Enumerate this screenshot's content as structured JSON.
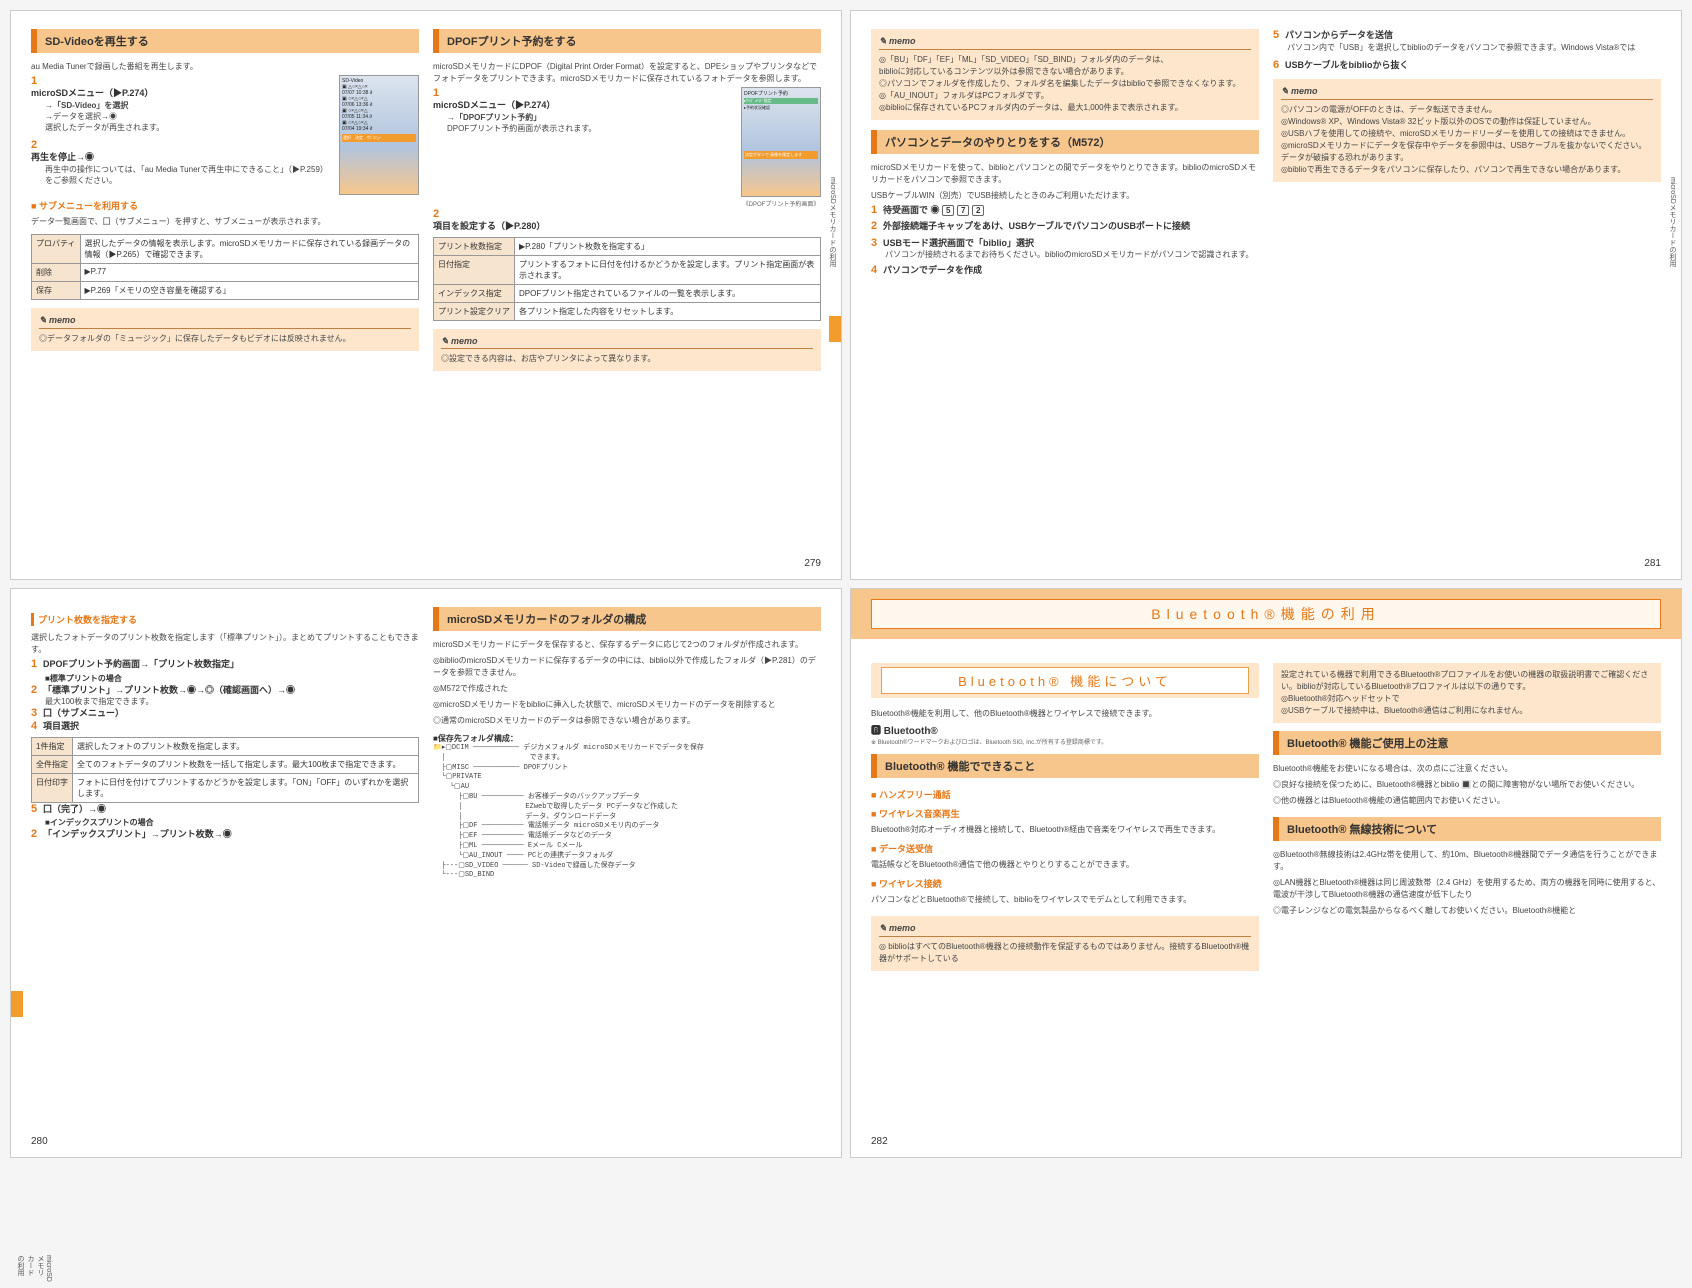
{
  "pages": {
    "p279_num": "279",
    "p280_num": "280",
    "p281_num": "281",
    "p282_num": "282",
    "side_tab": "microSDメモリカードの利用"
  },
  "p279": {
    "sd_video_header": "SD-Videoを再生する",
    "au_media": "au Media Tunerで録画した番組を再生します。",
    "step1_main": "microSDメニュー（▶P.274）",
    "step1_sub": "→「SD-Video」を選択",
    "step1_arrow": "→データを選択→◉",
    "desc1": "選択したデータが再生されます。",
    "step2": "再生を停止→◉",
    "step2_desc": "再生中の操作については、「au Media Tunerで再生中にできること」（▶P.259）をご参照ください。",
    "orange_sq1": "サブメニューを利用する",
    "sub_desc": "データ一覧画面で、囗（サブメニュー）を押すと、サブメニューが表示されます。",
    "tbl": {
      "r1a": "プロパティ",
      "r1b": "選択したデータの情報を表示します。microSDメモリカードに保存されている録画データの情報（▶P.265）で確認できます。",
      "r2a": "削除",
      "r2b": "▶P.77",
      "r3a": "保存",
      "r3b": "▶P.269「メモリの空き容量を確認する」"
    },
    "memo": "◎データフォルダの「ミュージック」に保存したデータもビデオには反映されません。"
  },
  "dpof": {
    "header": "DPOFプリント予約をする",
    "intro": "microSDメモリカードにDPOF（Digital Print Order Format）を設定すると、DPEショップやプリンタなどでフォトデータをプリントできます。microSDメモリカードに保存されているフォトデータを参照します。",
    "step1_main": "microSDメニュー（▶P.274）",
    "step1_sub": "→「DPOFプリント予約」",
    "step1_desc": "DPOFプリント予約画面が表示されます。",
    "caption": "《DPOFプリント予約画面》",
    "step2": "項目を設定する（▶P.280）",
    "tbl": {
      "r1a": "プリント枚数指定",
      "r1b": "▶P.280「プリント枚数を指定する」",
      "r2a": "日付指定",
      "r2b": "プリントするフォトに日付を付けるかどうかを設定します。プリント指定画面が表示されます。",
      "r3a": "インデックス指定",
      "r3b": "DPOFプリント指定されているファイルの一覧を表示します。",
      "r4a": "プリント設定クリア",
      "r4b": "各プリント指定した内容をリセットします。"
    },
    "memo": "◎設定できる内容は、お店やプリンタによって異なります。"
  },
  "p280": {
    "orange_bar": "プリント枚数を指定する",
    "desc1": "選択したフォトデータのプリント枚数を指定します（「標準プリント」）。まとめてプリントすることもできます。",
    "step1": "DPOFプリント予約画面→「プリント枚数指定」",
    "step1_sq": "■標準プリントの場合",
    "step2": "「標準プリント」→プリント枚数→◉→◎（確認画面へ）→◉",
    "step2_desc": "最大100枚まで指定できます。",
    "step3": "囗（サブメニュー）",
    "step4": "項目選択",
    "tbl": {
      "r1a": "1件指定",
      "r1b": "選択したフォトのプリント枚数を指定します。",
      "r2a": "全件指定",
      "r2b": "全てのフォトデータのプリント枚数を一括して指定します。最大100枚まで指定できます。",
      "r3a": "日付印字",
      "r3b": "フォトに日付を付けてプリントするかどうかを設定します。「ON」「OFF」のいずれかを選択します。"
    },
    "step5": "囗（完了）→◉",
    "step5_sq": "■インデックスプリントの場合",
    "step2b": "「インデックスプリント」→プリント枚数→◉"
  },
  "microsd_struct": {
    "header": "microSDメモリカードのフォルダの構成",
    "intro": "microSDメモリカードにデータを保存すると、保存するデータに応じて2つのフォルダが作成されます。",
    "line1": "◎biblioのmicroSDメモリカードに保存するデータの中には、biblio以外で作成したフォルダ（▶P.281）のデータを参照できません。",
    "line2": "◎M572で作成された",
    "line3": "◎microSDメモリカードをbiblioに挿入した状態で、microSDメモリカードのデータを削除すると",
    "line4": "◎通常のmicroSDメモリカードのデータは参照できない場合があります。",
    "tree_header": "■保存先フォルダ構成：",
    "tree": "📁▸▢DCIM ─────────── デジカメフォルダ microSDメモリカードでデータを保存\n  │                    できます。\n  ├▢MISC ─────────── DPOFプリント\n  └▢PRIVATE\n    └▢AU\n      ├▢BU ────────── お客様データのバックアップデータ\n      │               EZwebで取得したデータ PCデータなど作成した\n      │               データ、ダウンロードデータ\n      ├▢DF ────────── 電話帳データ microSDメモリ内のデータ\n      ├▢EF ────────── 電話帳データなどのデータ\n      ├▢ML ────────── Eメール Cメール\n      └▢AU_INOUT ──── PCとの連携データフォルダ\n  ├---▢SD_VIDEO ────── SD-Videoで録画した保存データ\n  └---▢SD_BIND"
  },
  "p281": {
    "memo1": {
      "l1": "◎「BU」「DF」「EF」「ML」「SD_VIDEO」「SD_BIND」フォルダ内のデータは、",
      "l2": "biblioに対応しているコンテンツ以外は参照できない場合があります。",
      "l3": "◎パソコンでフォルダを作成したり、フォルダ名を編集したデータはbiblioで参照できなくなります。",
      "l4": "◎「AU_INOUT」フォルダはPCフォルダです。",
      "l5": "◎biblioに保存されているPCフォルダ内のデータは、最大1,000件まで表示されます。"
    },
    "orange_header": "パソコンとデータのやりとりをする（M572）",
    "desc1": "microSDメモリカードを使って、biblioとパソコンとの間でデータをやりとりできます。biblioのmicroSDメモリカードをパソコンで参照できます。",
    "desc2": "USBケーブルWIN（別売）でUSB接続したときのみご利用いただけます。",
    "step1": "待受画面で ◉ 5 7 2",
    "step2": "外部接続端子キャップをあけ、USBケーブルでパソコンのUSBポートに接続",
    "step3": "USBモード選択画面で「biblio」選択",
    "step3_desc": "パソコンが接続されるまでお待ちください。biblioのmicroSDメモリカードがパソコンで認識されます。",
    "step4": "パソコンでデータを作成",
    "step5": "パソコンからデータを送信",
    "step5_desc": "パソコン内で「USB」を選択してbiblioのデータをパソコンで参照できます。Windows Vista®では",
    "step6": "USBケーブルをbiblioから抜く",
    "memo2": {
      "l1": "◎パソコンの電源がOFFのときは、データ転送できません。",
      "l2": "◎Windows® XP、Windows Vista® 32ビット版以外のOSでの動作は保証していません。",
      "l3": "◎USBハブを使用しての接続や、microSDメモリカードリーダーを使用しての接続はできません。",
      "l4": "◎microSDメモリカードにデータを保存中やデータを参照中は、USBケーブルを抜かないでください。データが破損する恐れがあります。",
      "l5": "◎biblioで再生できるデータをパソコンに保存したり、パソコンで再生できない場合があります。"
    }
  },
  "p282": {
    "band": "Bluetooth®機能の利用",
    "section_box": "Bluetooth® 機能について",
    "intro1": "Bluetooth®機能を利用して、他のBluetooth®機器とワイヤレスで接続できます。",
    "bt_logo": "🅱 Bluetooth®",
    "trademark": "※ Bluetooth®ワードマークおよびロゴは、Bluetooth SIG, Inc.が所有する登録商標です。",
    "header2": "Bluetooth® 機能でできること",
    "sq1": "ハンズフリー通話",
    "sq2": "ワイヤレス音楽再生",
    "sq2_desc": "Bluetooth®対応オーディオ機器と接続して、Bluetooth®経由で音楽をワイヤレスで再生できます。",
    "sq3": "データ送受信",
    "sq3_desc": "電話帳などをBluetooth®通信で他の機器とやりとりすることができます。",
    "sq4": "ワイヤレス接続",
    "sq4_desc": "パソコンなどとBluetooth®で接続して、biblioをワイヤレスでモデムとして利用できます。",
    "memo": "◎ biblioはすべてのBluetooth®機器との接続動作を保証するものではありません。接続するBluetooth®機器がサポートしている",
    "right_intro": "設定されている機器で利用できるBluetooth®プロファイルをお使いの機器の取扱説明書でご確認ください。biblioが対応しているBluetooth®プロファイルは以下の通りです。",
    "right_l1": "◎Bluetooth®対応ヘッドセットで",
    "right_l2": "◎USBケーブルで接続中は、Bluetooth®通信はご利用になれません。",
    "header3": "Bluetooth® 機能ご使用上の注意",
    "txt3": "Bluetooth®機能をお使いになる場合は、次の点にご注意ください。",
    "bullet3_1": "◎良好な接続を保つために、Bluetooth®機器とbiblio 🔳との間に障害物がない場所でお使いください。",
    "bullet3_2": "◎他の機器とはBluetooth®機能の通信範囲内でお使いください。",
    "header4": "Bluetooth® 無線技術について",
    "txt4_1": "◎Bluetooth®無線技術は2.4GHz帯を使用して、約10m、Bluetooth®機器間でデータ通信を行うことができます。",
    "txt4_2": "◎LAN機器とBluetooth®機器は同じ周波数帯（2.4 GHz）を使用するため、両方の機器を同時に使用すると、電波が干渉してBluetooth®機器の通信速度が低下したり",
    "txt4_3": "◎電子レンジなどの電気製品からなるべく離してお使いください。Bluetooth®機能と"
  }
}
